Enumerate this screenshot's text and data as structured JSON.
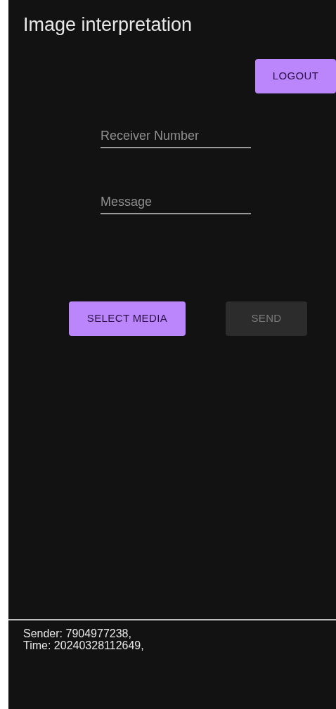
{
  "title": "Image interpretation",
  "logout_button": {
    "label": "LOGOUT"
  },
  "fields": [
    {
      "placeholder": "Receiver Number"
    },
    {
      "placeholder": "Message"
    }
  ],
  "actions": [
    {
      "label": "SELECT MEDIA",
      "disabled": false
    },
    {
      "label": "SEND",
      "disabled": true
    }
  ],
  "output": {
    "lines": [
      "Sender: 7904977238,",
      "Time: 20240328112649,"
    ]
  }
}
